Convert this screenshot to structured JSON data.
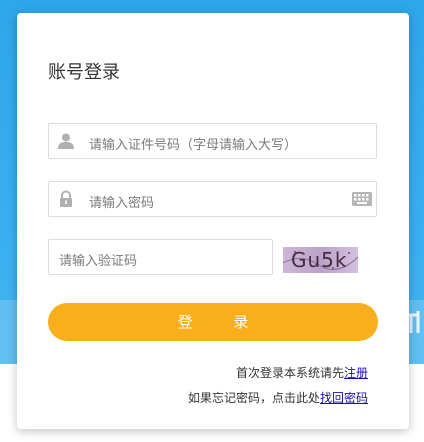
{
  "login": {
    "title": "账号登录",
    "id_placeholder": "请输入证件号码（字母请输入大写）",
    "password_placeholder": "请输入密码",
    "captcha_placeholder": "请输入验证码",
    "captcha_text": "Gu5k",
    "login_button": "登 录",
    "first_login_text": "首次登录本系统请先",
    "register_link": "注册",
    "forgot_text": "如果忘记密码，点击此处",
    "recover_link": "找回密码"
  },
  "icons": {
    "user": "user-icon",
    "lock": "lock-icon",
    "keyboard": "keyboard-icon"
  },
  "colors": {
    "accent": "#f9ae1c",
    "background": "#3bb0f0",
    "link": "#1a0dab"
  }
}
